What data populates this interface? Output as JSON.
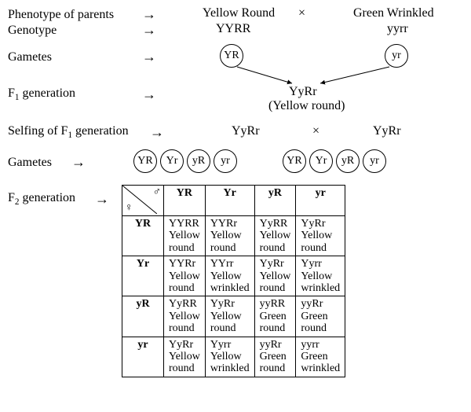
{
  "labels": {
    "phenotype_parents": "Phenotype of parents",
    "genotype": "Genotype",
    "gametes": "Gametes",
    "f1": "F₁ generation",
    "selfing": "Selfing of F₁ generation",
    "gametes2": "Gametes",
    "f2": "F₂ generation"
  },
  "parents": {
    "p1_pheno": "Yellow Round",
    "p1_geno": "YYRR",
    "p1_gamete": "YR",
    "cross": "×",
    "p2_pheno": "Green Wrinkled",
    "p2_geno": "yyrr",
    "p2_gamete": "yr"
  },
  "f1": {
    "genotype": "YyRr",
    "phenotype": "(Yellow round)"
  },
  "selfing": {
    "left": "YyRr",
    "cross": "×",
    "right": "YyRr"
  },
  "gametes_f1_left": [
    "YR",
    "Yr",
    "yR",
    "yr"
  ],
  "gametes_f1_right": [
    "YR",
    "Yr",
    "yR",
    "yr"
  ],
  "punnett": {
    "col_heads": [
      "YR",
      "Yr",
      "yR",
      "yr"
    ],
    "row_heads": [
      "YR",
      "Yr",
      "yR",
      "yr"
    ],
    "cells": [
      [
        {
          "g": "YYRR",
          "p1": "Yellow",
          "p2": "round"
        },
        {
          "g": "YYRr",
          "p1": "Yellow",
          "p2": "round"
        },
        {
          "g": "YyRR",
          "p1": "Yellow",
          "p2": "round"
        },
        {
          "g": "YyRr",
          "p1": "Yellow",
          "p2": "round"
        }
      ],
      [
        {
          "g": "YYRr",
          "p1": "Yellow",
          "p2": "round"
        },
        {
          "g": "YYrr",
          "p1": "Yellow",
          "p2": "wrinkled"
        },
        {
          "g": "YyRr",
          "p1": "Yellow",
          "p2": "round"
        },
        {
          "g": "Yyrr",
          "p1": "Yellow",
          "p2": "wrinkled"
        }
      ],
      [
        {
          "g": "YyRR",
          "p1": "Yellow",
          "p2": "round"
        },
        {
          "g": "YyRr",
          "p1": "Yellow",
          "p2": "round"
        },
        {
          "g": "yyRR",
          "p1": "Green",
          "p2": "round"
        },
        {
          "g": "yyRr",
          "p1": "Green",
          "p2": "round"
        }
      ],
      [
        {
          "g": "YyRr",
          "p1": "Yellow",
          "p2": "round"
        },
        {
          "g": "Yyrr",
          "p1": "Yellow",
          "p2": "wrinkled"
        },
        {
          "g": "yyRr",
          "p1": "Green",
          "p2": "round"
        },
        {
          "g": "yyrr",
          "p1": "Green",
          "p2": "wrinkled"
        }
      ]
    ]
  },
  "symbols": {
    "female": "♀",
    "male": "♂"
  }
}
